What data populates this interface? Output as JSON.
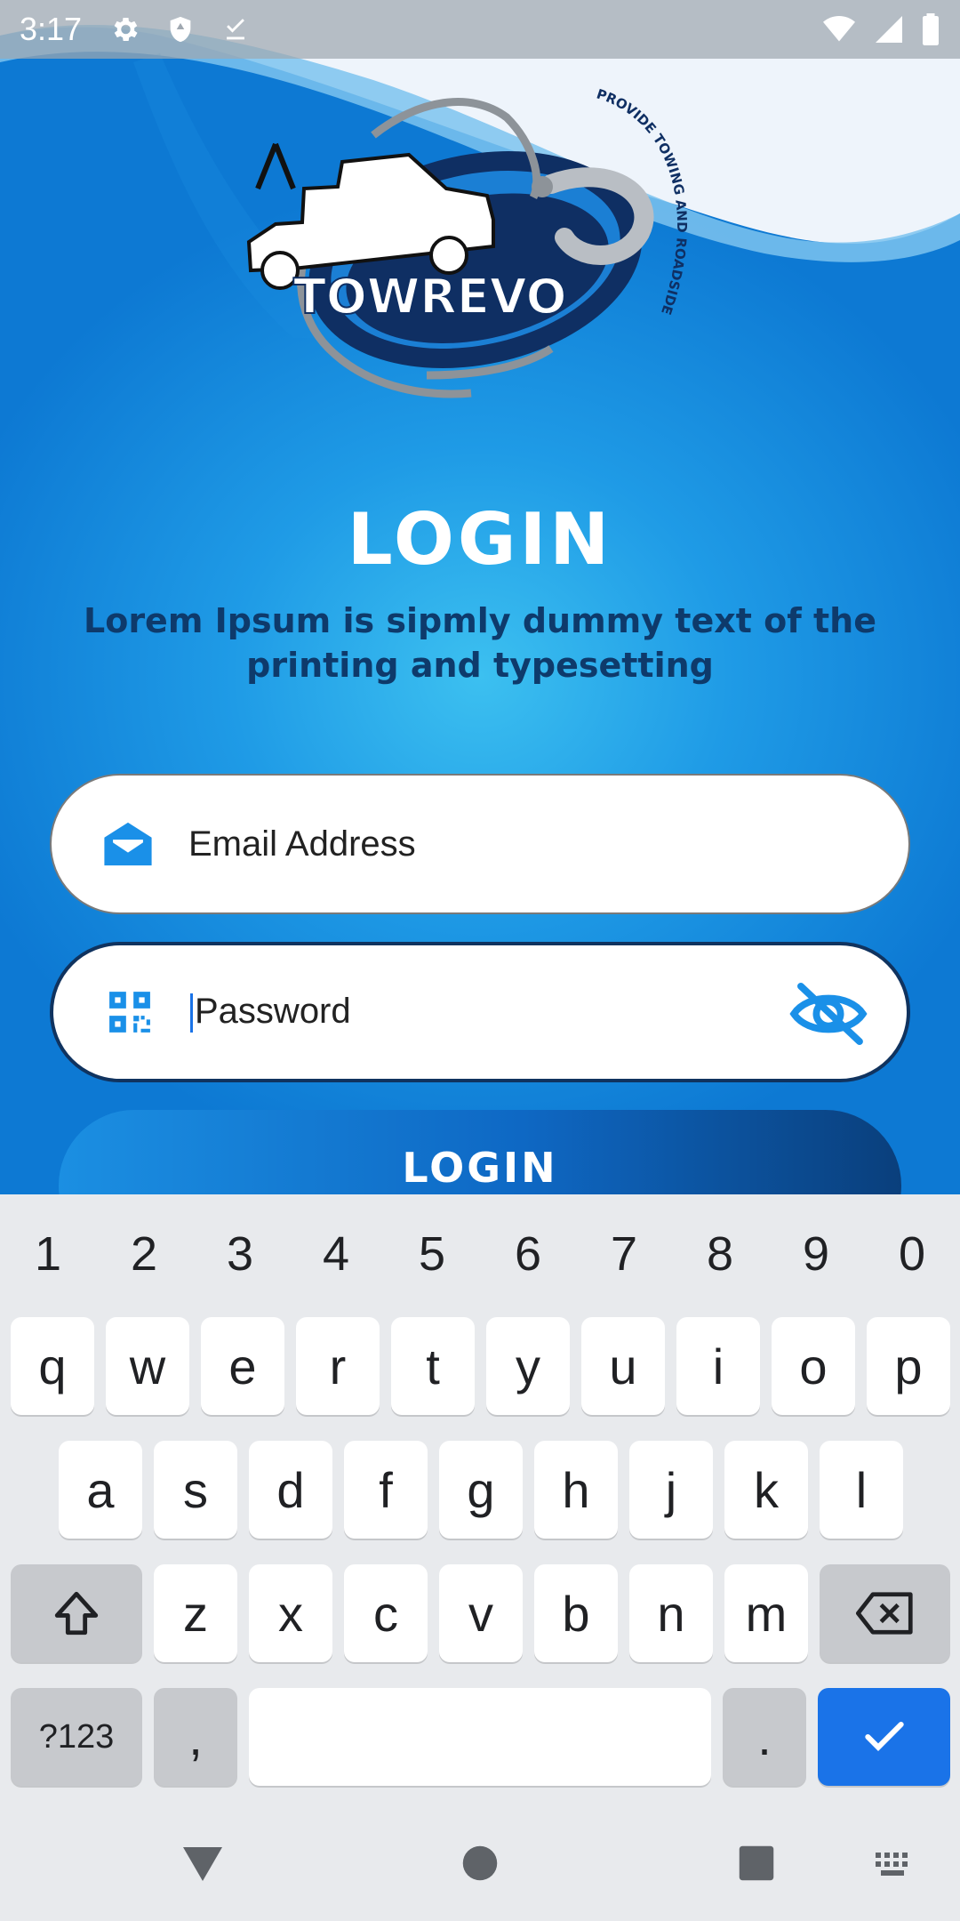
{
  "status_bar": {
    "time": "3:17"
  },
  "hero": {
    "title": "LOGIN",
    "subtitle": "Lorem Ipsum is sipmly dummy text of the printing and typesetting"
  },
  "logo": {
    "brand": "TOWREVO",
    "tagline": "PROVIDE TOWING AND ROADSIDE ASSISTANCE"
  },
  "form": {
    "email_label": "Email Address",
    "password_label": "Password",
    "login_button": "LOGIN"
  },
  "keyboard": {
    "number_row": [
      "1",
      "2",
      "3",
      "4",
      "5",
      "6",
      "7",
      "8",
      "9",
      "0"
    ],
    "row1": [
      "q",
      "w",
      "e",
      "r",
      "t",
      "y",
      "u",
      "i",
      "o",
      "p"
    ],
    "row2": [
      "a",
      "s",
      "d",
      "f",
      "g",
      "h",
      "j",
      "k",
      "l"
    ],
    "row3": [
      "z",
      "x",
      "c",
      "v",
      "b",
      "n",
      "m"
    ],
    "symbols_key": "?123",
    "comma_key": ",",
    "period_key": "."
  },
  "colors": {
    "accent": "#1a73e8",
    "brand_dark": "#10335f",
    "brand_blue": "#1f9be6"
  }
}
